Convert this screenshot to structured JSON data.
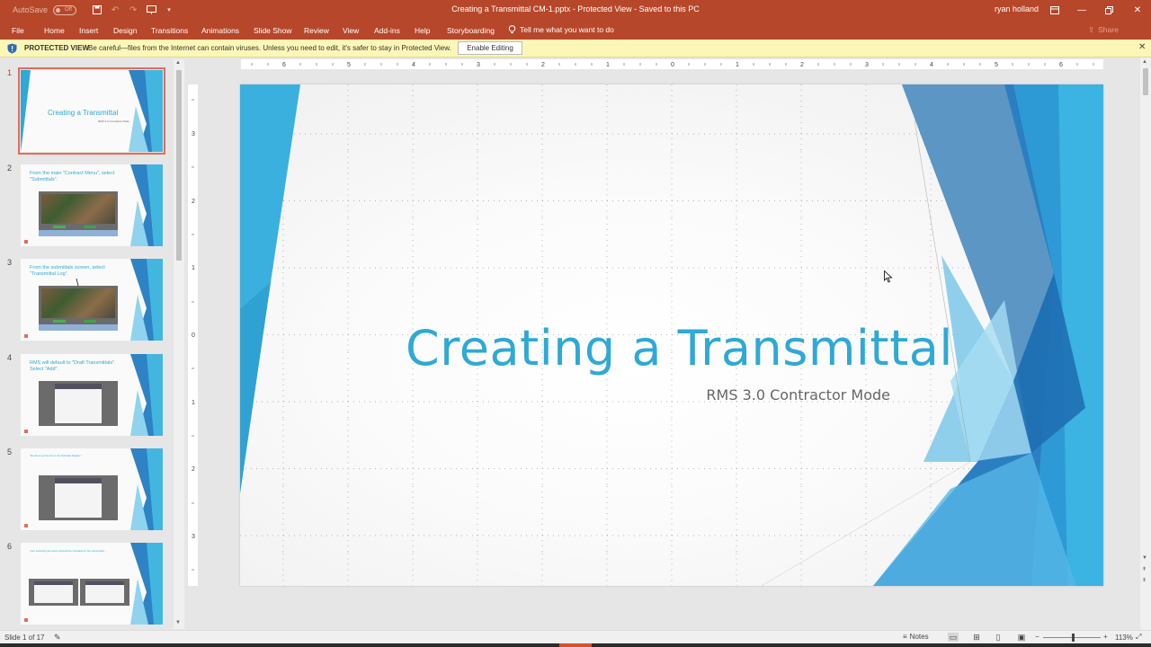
{
  "titlebar": {
    "autosave_label": "AutoSave",
    "autosave_state": "Off",
    "doc_title": "Creating a Transmittal CM-1.pptx  -  Protected View  -  Saved to this PC",
    "user_name": "ryan holland",
    "accent_color": "#b7472a"
  },
  "tabs": [
    "File",
    "Home",
    "Insert",
    "Design",
    "Transitions",
    "Animations",
    "Slide Show",
    "Review",
    "View",
    "Add-ins",
    "Help",
    "Storyboarding"
  ],
  "tell_me": "Tell me what you want to do",
  "share_label": "Share",
  "protected": {
    "title": "PROTECTED VIEW",
    "message": "Be careful—files from the Internet can contain viruses. Unless you need to edit, it's safer to stay in Protected View.",
    "button": "Enable Editing"
  },
  "thumbnails": [
    {
      "num": "1",
      "title": "Creating a Transmittal",
      "subtitle": "RMS 3.0 Contractor Mode"
    },
    {
      "num": "2",
      "text": "From the main \"Contract Menu\", select \"Submittals\"."
    },
    {
      "num": "3",
      "text": "From the submittals screen, select \"Transmittal Log\"."
    },
    {
      "num": "4",
      "text": "RMS will default to \"Draft Transmittals\". Select \"Add\"."
    },
    {
      "num": "5",
      "text": "\"Specify to use the items in the Submitted Register\" …"
    },
    {
      "num": "6",
      "text": "Your selecting the items that will be included on the transmittal…"
    }
  ],
  "slide": {
    "title": "Creating a Transmittal",
    "subtitle": "RMS 3.0 Contractor Mode",
    "title_color": "#2fa9d5"
  },
  "ruler": {
    "horizontal": [
      "6",
      "5",
      "4",
      "3",
      "2",
      "1",
      "0",
      "1",
      "2",
      "3",
      "4",
      "5",
      "6"
    ],
    "vertical": [
      "3",
      "2",
      "1",
      "0",
      "1",
      "2",
      "3"
    ]
  },
  "status": {
    "slide_count": "Slide 1 of 17",
    "notes": "Notes",
    "zoom": "113%"
  }
}
